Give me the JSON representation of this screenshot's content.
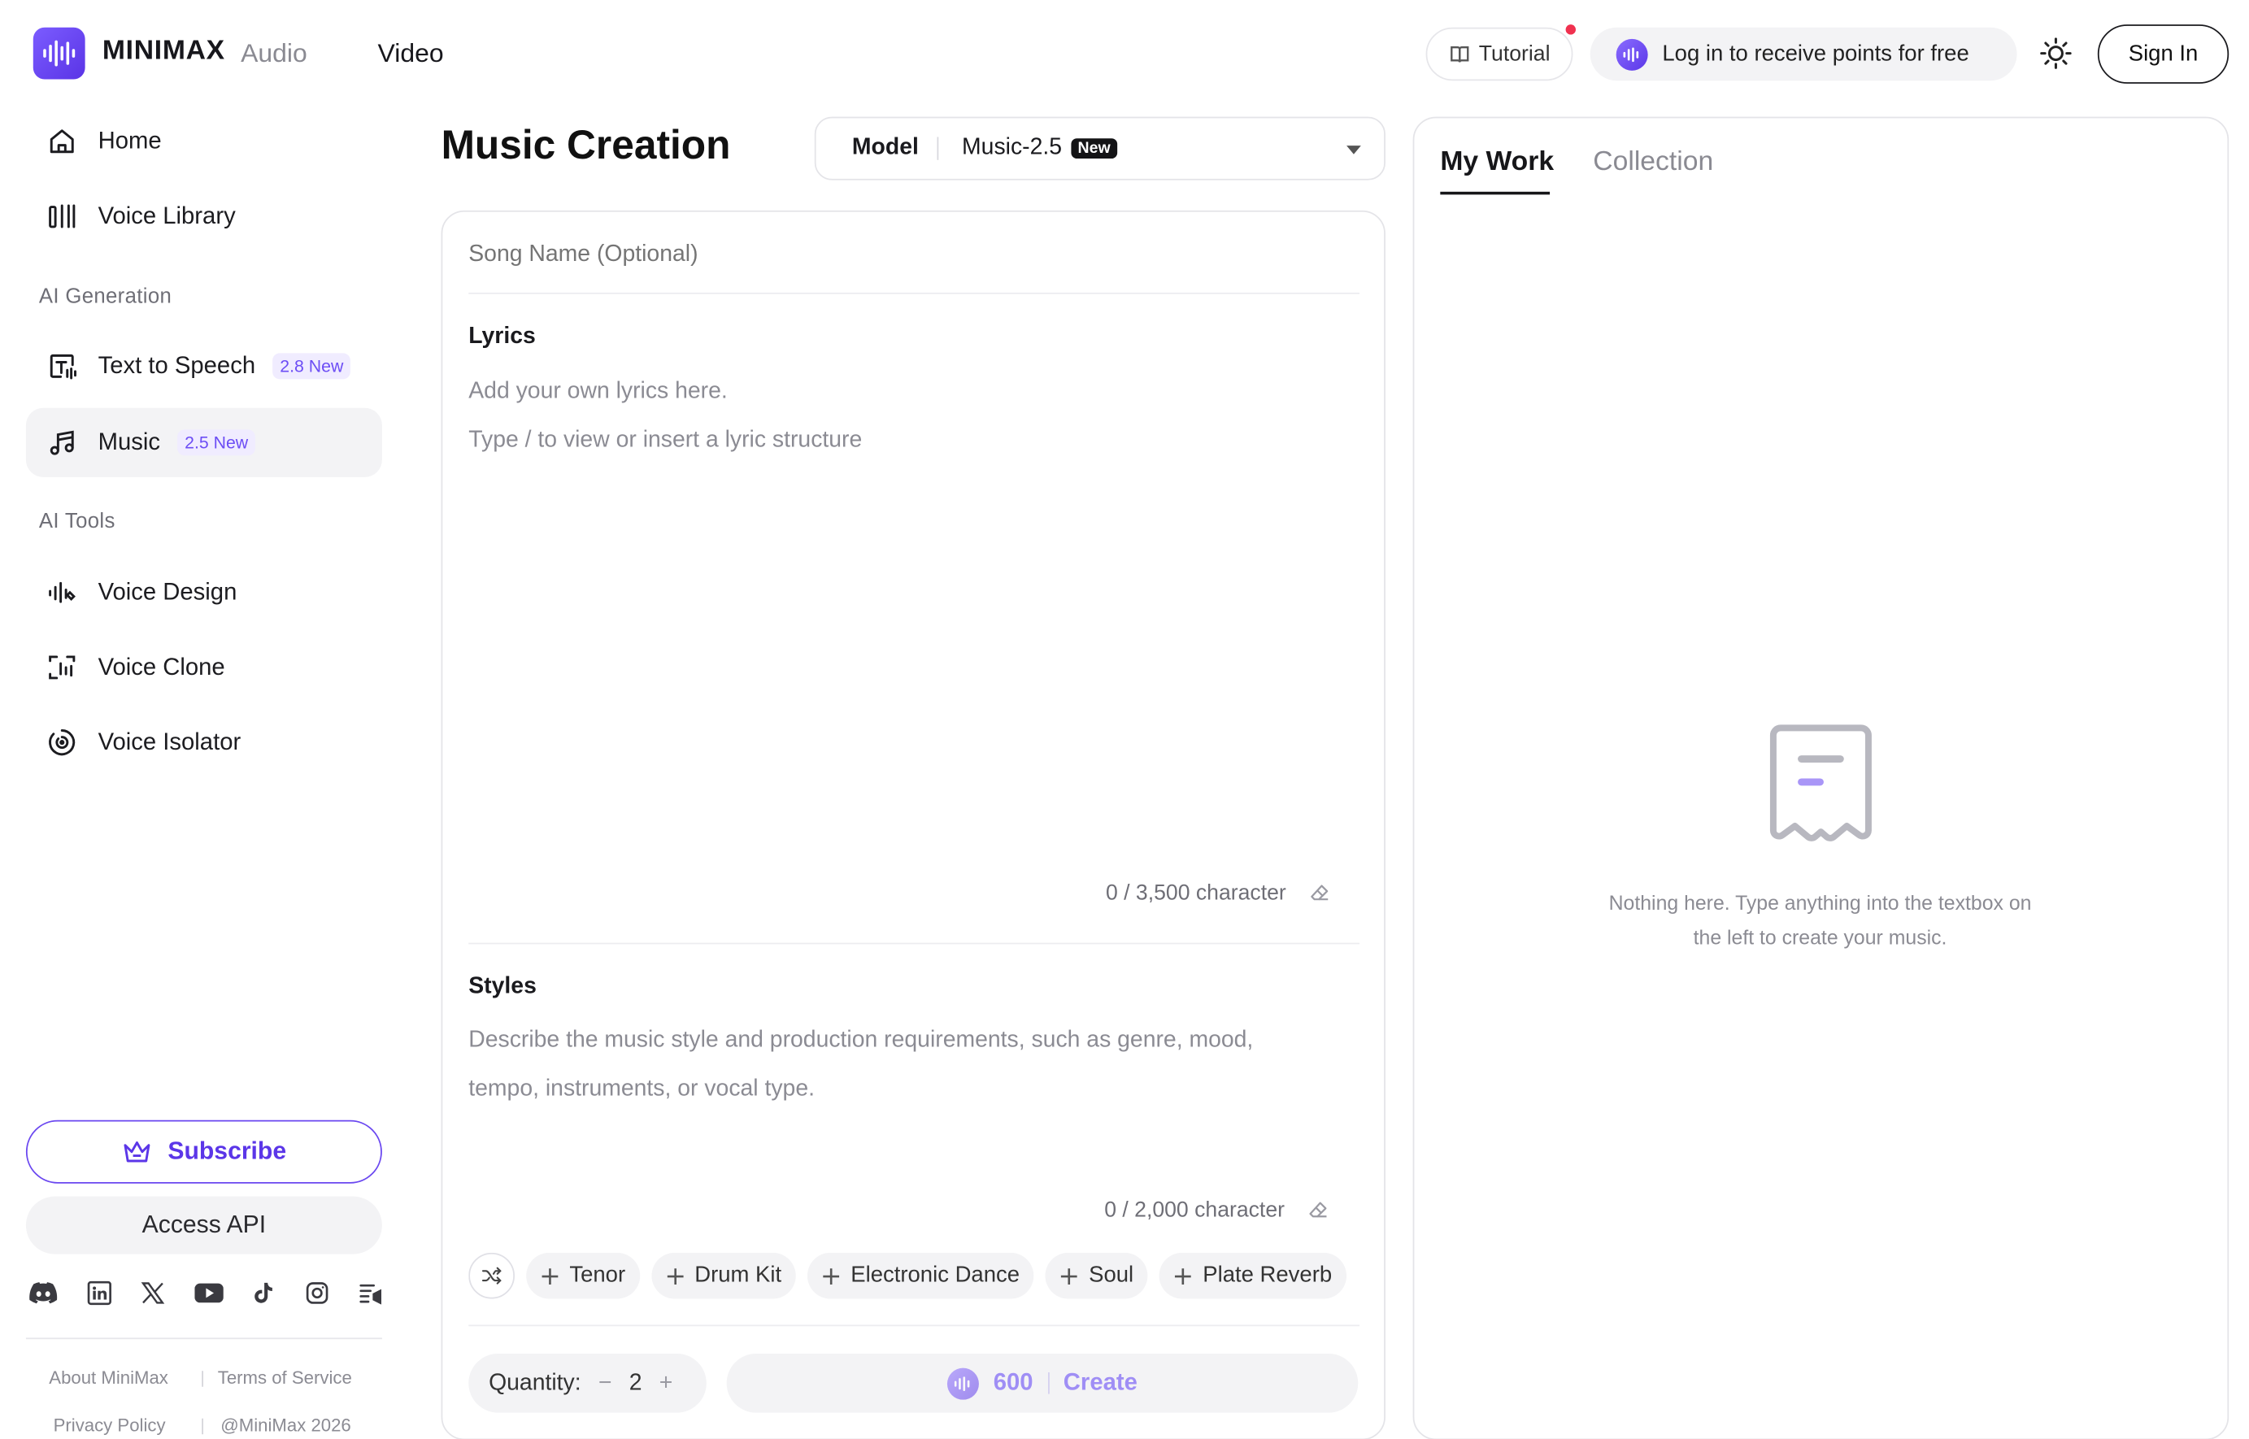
{
  "header": {
    "brand": "MINIMAX",
    "tabs": [
      "Audio",
      "Video"
    ],
    "tutorial_label": "Tutorial",
    "points_label": "Log in to receive points for free",
    "signin_label": "Sign In"
  },
  "sidebar": {
    "items_top": [
      {
        "label": "Home",
        "icon": "home-icon"
      },
      {
        "label": "Voice Library",
        "icon": "library-icon"
      }
    ],
    "section_generation": "AI Generation",
    "items_generation": [
      {
        "label": "Text to Speech",
        "badge": "2.8 New",
        "icon": "text-to-speech-icon"
      },
      {
        "label": "Music",
        "badge": "2.5 New",
        "icon": "music-note-icon",
        "active": true
      }
    ],
    "section_tools": "AI Tools",
    "items_tools": [
      {
        "label": "Voice Design",
        "icon": "voice-design-icon"
      },
      {
        "label": "Voice Clone",
        "icon": "voice-clone-icon"
      },
      {
        "label": "Voice Isolator",
        "icon": "voice-isolator-icon"
      }
    ],
    "subscribe_label": "Subscribe",
    "api_label": "Access API",
    "socials": [
      "discord-icon",
      "linkedin-icon",
      "x-icon",
      "youtube-icon",
      "tiktok-icon",
      "instagram-icon",
      "changelog-icon"
    ],
    "footer": {
      "about": "About MiniMax",
      "terms": "Terms of Service",
      "privacy": "Privacy Policy",
      "copyright": "@MiniMax 2026"
    }
  },
  "main": {
    "title": "Music Creation",
    "model": {
      "label": "Model",
      "value": "Music-2.5",
      "tag": "New"
    },
    "song_name_placeholder": "Song Name (Optional)",
    "lyrics": {
      "heading": "Lyrics",
      "placeholder_line1": "Add your own lyrics here.",
      "placeholder_line2": "Type / to view or insert a lyric structure",
      "count": "0 / 3,500 character"
    },
    "styles": {
      "heading": "Styles",
      "placeholder_line1": "Describe the music style and production requirements, such as genre, mood,",
      "placeholder_line2": "tempo, instruments, or vocal type.",
      "count": "0 / 2,000 character"
    },
    "style_tags": [
      "Tenor",
      "Drum Kit",
      "Electronic Dance",
      "Soul",
      "Plate Reverb"
    ],
    "quantity": {
      "label": "Quantity:",
      "minus": "−",
      "value": "2",
      "plus": "+"
    },
    "create": {
      "cost": "600",
      "label": "Create"
    }
  },
  "right_panel": {
    "tabs": [
      "My Work",
      "Collection"
    ],
    "empty_line1": "Nothing here. Type anything into the textbox on",
    "empty_line2": "the left to create your music."
  },
  "colors": {
    "accent": "#5b36e8",
    "badge_bg": "#f0ecff",
    "notification": "#f0314f"
  }
}
